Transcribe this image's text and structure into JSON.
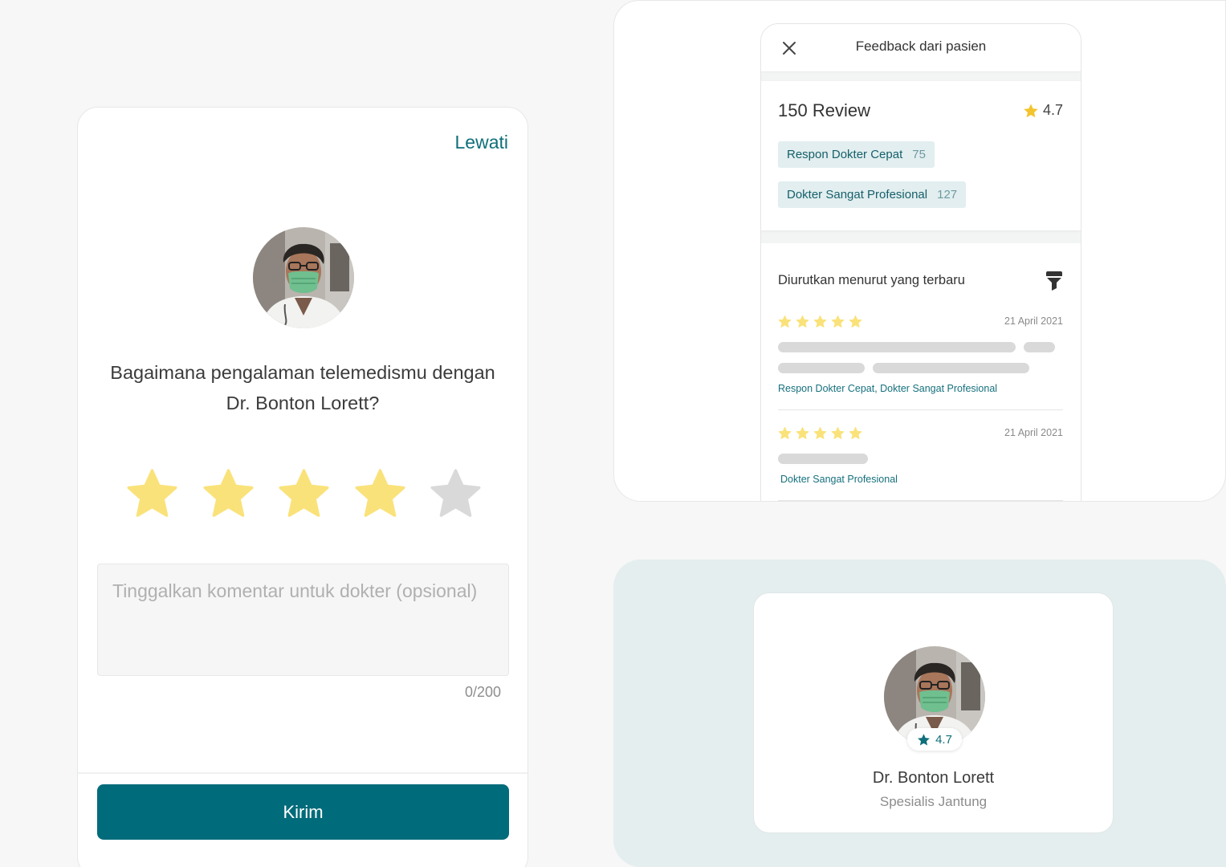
{
  "rating_screen": {
    "skip_label": "Lewati",
    "question": "Bagaimana pengalaman telemedismu dengan Dr. Bonton Lorett?",
    "rating_value": 4,
    "rating_max": 5,
    "comment_placeholder": "Tinggalkan komentar untuk dokter (opsional)",
    "comment_value": "",
    "char_counter": "0/200",
    "submit_label": "Kirim"
  },
  "feedback_panel": {
    "title": "Feedback dari pasien",
    "review_count": "150 Review",
    "average_rating": "4.7",
    "chips": [
      {
        "label": "Respon Dokter Cepat",
        "count": "75"
      },
      {
        "label": "Dokter Sangat Profesional",
        "count": "127"
      }
    ],
    "sort_label": "Diurutkan menurut yang terbaru",
    "reviews": [
      {
        "stars": 5,
        "date": "21 April 2021",
        "tags": "Respon Dokter Cepat, Dokter Sangat Profesional"
      },
      {
        "stars": 5,
        "date": "21 April 2021",
        "tags": "Dokter Sangat Profesional"
      }
    ]
  },
  "doctor_card": {
    "name": "Dr. Bonton Lorett",
    "specialty": "Spesialis Jantung",
    "rating": "4.7"
  },
  "colors": {
    "primary": "#006b7a",
    "star_filled": "#fae27a",
    "star_empty": "#d9d9d9",
    "chip_bg": "#e2eeef",
    "accent_bg": "#e4eeef"
  },
  "icons": {
    "close": "close-icon",
    "filter": "filter-icon",
    "star": "star-icon",
    "avatar": "doctor-avatar"
  }
}
